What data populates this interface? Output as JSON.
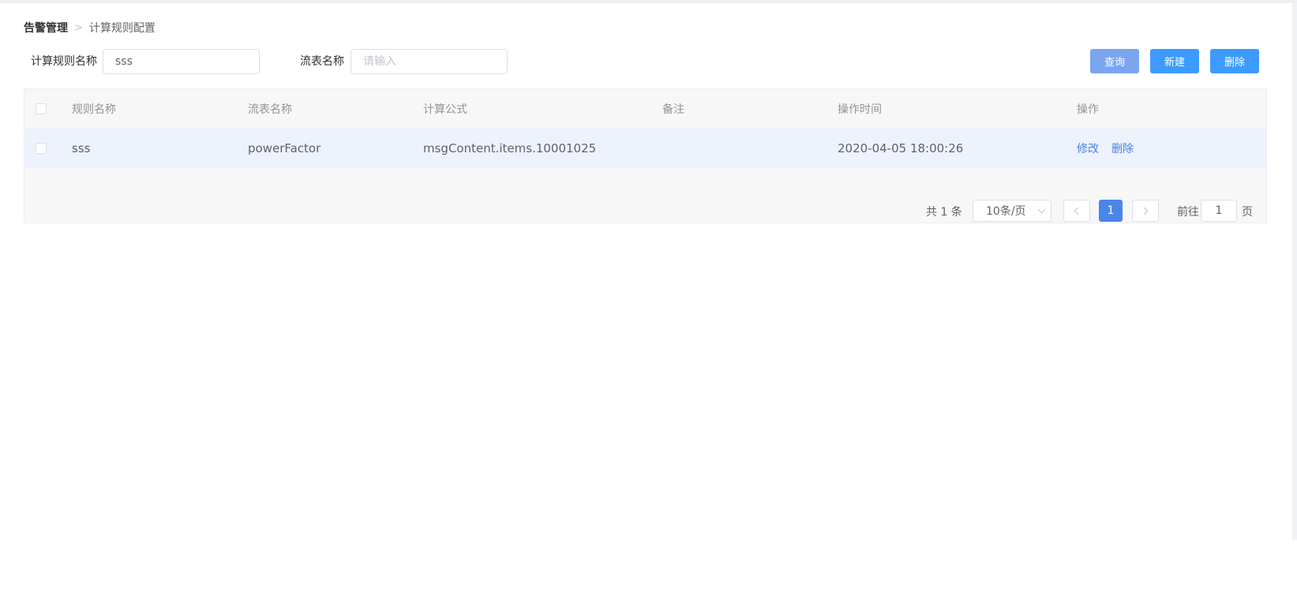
{
  "breadcrumb": {
    "first": "告警管理",
    "second": "计算规则配置"
  },
  "filters": {
    "rule_name_label": "计算规则名称",
    "rule_name_value": "sss",
    "stream_name_label": "流表名称",
    "stream_name_placeholder": "请输入"
  },
  "toolbar": {
    "query_label": "查询",
    "new_label": "新建",
    "delete_label": "删除"
  },
  "table": {
    "headers": [
      "规则名称",
      "流表名称",
      "计算公式",
      "备注",
      "操作时间",
      "操作"
    ],
    "rows": [
      {
        "rule_name": "sss",
        "stream_name": "powerFactor",
        "formula": "msgContent.items.10001025",
        "remark": "",
        "op_time": "2020-04-05 18:00:26",
        "edit": "修改",
        "delete": "删除"
      }
    ]
  },
  "pagination": {
    "total": "共 1 条",
    "page_size": "10条/页",
    "current_page": "1",
    "goto_label": "前往",
    "goto_value": "1",
    "page_label": "页"
  },
  "colors": {
    "primary": "#3d9bff",
    "query_button": "#7aa6f0",
    "link": "#4a7fe0",
    "current_page": "#4a85ea"
  },
  "icons": {
    "breadcrumb_separator": "chevron-right-icon",
    "select_arrow": "chevron-down-icon",
    "prev": "chevron-left-icon",
    "next": "chevron-right-icon"
  }
}
